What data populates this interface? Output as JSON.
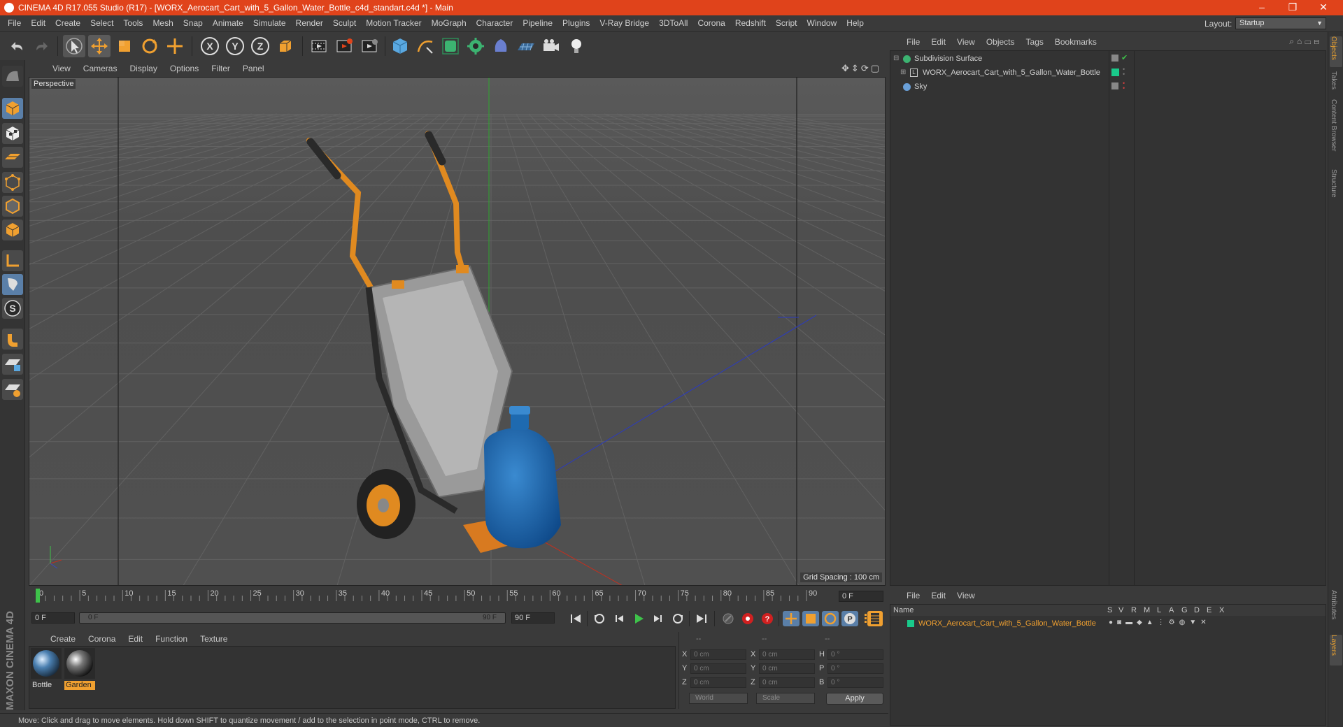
{
  "app": {
    "title": "CINEMA 4D R17.055 Studio (R17) - [WORX_Aerocart_Cart_with_5_Gallon_Water_Bottle_c4d_standart.c4d *] - Main",
    "window_buttons": [
      "–",
      "❐",
      "✕"
    ]
  },
  "menubar": {
    "items": [
      "File",
      "Edit",
      "Create",
      "Select",
      "Tools",
      "Mesh",
      "Snap",
      "Animate",
      "Simulate",
      "Render",
      "Sculpt",
      "Motion Tracker",
      "MoGraph",
      "Character",
      "Pipeline",
      "Plugins",
      "V-Ray Bridge",
      "3DToAll",
      "Corona",
      "Redshift",
      "Script",
      "Window",
      "Help"
    ],
    "layout_label": "Layout:",
    "layout_value": "Startup"
  },
  "viewport": {
    "menu": [
      "View",
      "Cameras",
      "Display",
      "Options",
      "Filter",
      "Panel"
    ],
    "label": "Perspective",
    "grid_spacing": "Grid Spacing : 100 cm"
  },
  "timeline": {
    "ticks": [
      "0",
      "5",
      "10",
      "15",
      "20",
      "25",
      "30",
      "35",
      "40",
      "45",
      "50",
      "55",
      "60",
      "65",
      "70",
      "75",
      "80",
      "85",
      "90"
    ],
    "current_frame": "0 F",
    "start_field": "0 F",
    "range_start": "0 F",
    "range_end": "90 F",
    "end_field": "90 F"
  },
  "materials": {
    "menu": [
      "Create",
      "Corona",
      "Edit",
      "Function",
      "Texture"
    ],
    "items": [
      {
        "name": "Bottle",
        "selected": false
      },
      {
        "name": "Garden",
        "selected": true
      }
    ]
  },
  "coordinates": {
    "header": [
      "--",
      "--",
      "--"
    ],
    "rows": [
      {
        "a": "X",
        "av": "0 cm",
        "b": "X",
        "bv": "0 cm",
        "c": "H",
        "cv": "0 °"
      },
      {
        "a": "Y",
        "av": "0 cm",
        "b": "Y",
        "bv": "0 cm",
        "c": "P",
        "cv": "0 °"
      },
      {
        "a": "Z",
        "av": "0 cm",
        "b": "Z",
        "bv": "0 cm",
        "c": "B",
        "cv": "0 °"
      }
    ],
    "mode": "World",
    "transform": "Scale",
    "apply": "Apply"
  },
  "status": "Move: Click and drag to move elements. Hold down SHIFT to quantize movement / add to the selection in point mode, CTRL to remove.",
  "object_manager": {
    "menu": [
      "File",
      "Edit",
      "View",
      "Objects",
      "Tags",
      "Bookmarks"
    ],
    "objects": [
      {
        "name": "Subdivision Surface",
        "color": "#3cb371"
      },
      {
        "name": "WORX_Aerocart_Cart_with_5_Gallon_Water_Bottle",
        "color": "#19c98a"
      },
      {
        "name": "Sky",
        "color": "#6aa0d8"
      }
    ]
  },
  "layer_manager": {
    "menu": [
      "File",
      "Edit",
      "View"
    ],
    "columns": [
      "Name",
      "S",
      "V",
      "R",
      "M",
      "L",
      "A",
      "G",
      "D",
      "E",
      "X"
    ],
    "layers": [
      {
        "name": "WORX_Aerocart_Cart_with_5_Gallon_Water_Bottle",
        "color": "#19c98a"
      }
    ]
  },
  "right_tabs": [
    "Objects",
    "Takes",
    "Content Browser",
    "Structure",
    "Attributes",
    "Layers"
  ],
  "colors": {
    "title_bar": "#e0431b",
    "accent_orange": "#e8a030",
    "active_green": "#19c98a"
  }
}
